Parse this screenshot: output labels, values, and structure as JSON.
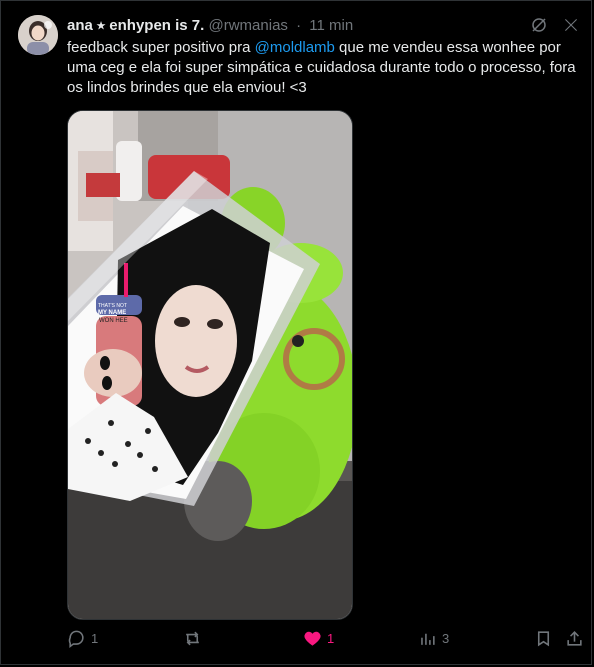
{
  "tweet": {
    "display_name": "ana ⭒ enhypen is 7.",
    "handle": "@rwmanias",
    "dot": "·",
    "time": "11 min",
    "text_before": "feedback super positivo pra ",
    "mention": "@moldlamb",
    "text_after": " que me vendeu essa wonhee por uma ceg e ela foi super simpática e cuidadosa durante todo o processo, fora os lindos brindes que ela enviou! <3"
  },
  "media": {
    "photocard_tag_top": "THAT'S NOT",
    "photocard_tag_title": "MY NAME",
    "photocard_tag_name": "WON HEE"
  },
  "actions": {
    "replies": "1",
    "likes": "1",
    "views": "3"
  },
  "colors": {
    "background": "#000000",
    "text": "#e7e9ea",
    "muted": "#71767b",
    "link": "#1d9bf0",
    "like": "#f91880"
  },
  "icons": {
    "top_right": [
      "grok-icon",
      "more-icon"
    ],
    "actions": [
      "reply-icon",
      "retweet-icon",
      "heart-icon",
      "views-icon",
      "bookmark-icon",
      "share-icon"
    ]
  }
}
